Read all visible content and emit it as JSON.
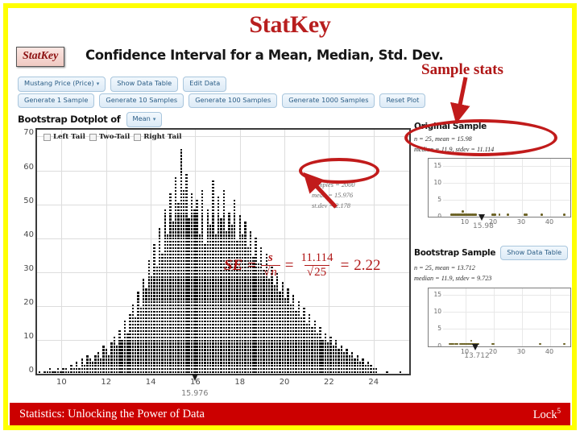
{
  "slide": {
    "title": "StatKey",
    "frame_color": "#ffff00",
    "accent_color": "#b01616"
  },
  "app": {
    "logo": "StatKey",
    "title": "Confidence Interval for a Mean, Median, Std. Dev.",
    "toolbar_row1": [
      {
        "label": "Mustang Price (Price)",
        "caret": "▾"
      },
      {
        "label": "Show Data Table",
        "caret": ""
      },
      {
        "label": "Edit Data",
        "caret": ""
      }
    ],
    "toolbar_row2": [
      {
        "label": "Generate 1 Sample",
        "caret": ""
      },
      {
        "label": "Generate 10 Samples",
        "caret": ""
      },
      {
        "label": "Generate 100 Samples",
        "caret": ""
      },
      {
        "label": "Generate 1000 Samples",
        "caret": ""
      },
      {
        "label": "Reset Plot",
        "caret": ""
      }
    ],
    "dotplot_heading": "Bootstrap Dotplot of",
    "statistic_select": "Mean",
    "statistic_caret": "▾",
    "tails": [
      {
        "label": "Left Tail",
        "checked": false
      },
      {
        "label": "Two-Tail",
        "checked": false
      },
      {
        "label": "Right Tail",
        "checked": false
      }
    ]
  },
  "main_plot_stats": {
    "samples": "samples = 2000",
    "mean": "mean = 15.976",
    "stdev": "st.dev = 2.178"
  },
  "se_formula": {
    "lhs": "SE",
    "eq1": "=",
    "s": "s",
    "n": "n",
    "eq2": "=",
    "numerator": "11.114",
    "denominator": "25",
    "eq3": "=",
    "result": "2.22"
  },
  "annotations": {
    "sample_stats_label": "Sample stats"
  },
  "original_sample": {
    "title": "Original Sample",
    "line1": "n = 25, mean = 15.98",
    "line2": "median = 11.9, stdev = 11.114",
    "marker_label": "15.98"
  },
  "bootstrap_sample": {
    "title": "Bootstrap Sample",
    "button_label": "Show Data Table",
    "line1": "n = 25, mean = 13.712",
    "line2": "median = 11.9, stdev = 9.723",
    "marker_label": "13.712"
  },
  "footer": {
    "left": "Statistics: Unlocking the Power of Data",
    "right": "Lock",
    "right_sup": "5",
    "bar_color": "#cc0000"
  },
  "chart_data": [
    {
      "type": "bar",
      "name": "bootstrap-dotplot-main",
      "title": "Bootstrap Dotplot of Mean",
      "xlabel": "",
      "ylabel": "",
      "xlim": [
        8.9,
        25.6
      ],
      "ylim": [
        0,
        72
      ],
      "xticks": [
        10,
        12,
        14,
        16,
        18,
        20,
        22,
        24
      ],
      "yticks": [
        0,
        10,
        20,
        30,
        40,
        50,
        60,
        70
      ],
      "grid": true,
      "marker_value": 15.976,
      "marker_label": "15.976",
      "samples": 2000,
      "mean": 15.976,
      "stdev": 2.178,
      "bin_width": 0.12,
      "x": [
        9.0,
        9.12,
        9.24,
        9.36,
        9.48,
        9.6,
        9.72,
        9.84,
        9.96,
        10.08,
        10.2,
        10.32,
        10.44,
        10.56,
        10.68,
        10.8,
        10.92,
        11.04,
        11.16,
        11.28,
        11.4,
        11.52,
        11.64,
        11.76,
        11.88,
        12.0,
        12.12,
        12.24,
        12.36,
        12.48,
        12.6,
        12.72,
        12.84,
        12.96,
        13.08,
        13.2,
        13.32,
        13.44,
        13.56,
        13.68,
        13.8,
        13.92,
        14.04,
        14.16,
        14.28,
        14.4,
        14.52,
        14.64,
        14.76,
        14.88,
        15.0,
        15.12,
        15.24,
        15.36,
        15.48,
        15.6,
        15.72,
        15.84,
        15.96,
        16.08,
        16.2,
        16.32,
        16.44,
        16.56,
        16.68,
        16.8,
        16.92,
        17.04,
        17.16,
        17.28,
        17.4,
        17.52,
        17.64,
        17.76,
        17.88,
        18.0,
        18.12,
        18.24,
        18.36,
        18.48,
        18.6,
        18.72,
        18.84,
        18.96,
        19.08,
        19.2,
        19.32,
        19.44,
        19.56,
        19.68,
        19.8,
        19.92,
        20.04,
        20.16,
        20.28,
        20.4,
        20.52,
        20.64,
        20.76,
        20.88,
        21.0,
        21.12,
        21.24,
        21.36,
        21.48,
        21.6,
        21.72,
        21.84,
        21.96,
        22.08,
        22.2,
        22.32,
        22.44,
        22.56,
        22.68,
        22.8,
        22.92,
        23.04,
        23.16,
        23.28,
        23.4,
        23.52,
        23.64,
        23.76,
        23.88,
        24.0,
        24.12,
        24.6,
        25.2
      ],
      "counts": [
        1,
        0,
        1,
        1,
        2,
        1,
        1,
        2,
        1,
        2,
        2,
        1,
        3,
        2,
        4,
        2,
        5,
        3,
        6,
        5,
        4,
        6,
        7,
        5,
        9,
        8,
        6,
        10,
        12,
        9,
        14,
        11,
        17,
        13,
        19,
        22,
        18,
        26,
        21,
        30,
        27,
        36,
        31,
        41,
        34,
        46,
        38,
        52,
        44,
        57,
        48,
        62,
        54,
        71,
        58,
        63,
        49,
        57,
        52,
        55,
        44,
        58,
        41,
        52,
        47,
        61,
        44,
        56,
        49,
        58,
        45,
        51,
        47,
        55,
        42,
        50,
        44,
        48,
        40,
        45,
        37,
        43,
        35,
        40,
        33,
        38,
        30,
        34,
        28,
        32,
        26,
        29,
        24,
        27,
        22,
        25,
        20,
        23,
        18,
        21,
        16,
        19,
        15,
        17,
        13,
        15,
        11,
        13,
        10,
        12,
        9,
        11,
        8,
        9,
        7,
        8,
        6,
        7,
        5,
        6,
        4,
        5,
        3,
        4,
        3,
        2,
        2,
        1,
        1
      ]
    },
    {
      "type": "scatter",
      "name": "original-sample-dotplot",
      "title": "Original Sample",
      "xlim": [
        2,
        46
      ],
      "ylim": [
        0,
        17
      ],
      "xticks": [
        10,
        20,
        30,
        40
      ],
      "yticks": [
        0,
        5,
        10,
        15
      ],
      "grid": true,
      "n": 25,
      "mean": 15.98,
      "median": 11.9,
      "stdev": 11.114,
      "marker_value": 15.98,
      "values": [
        5.0,
        5.5,
        6.0,
        6.5,
        7.0,
        7.5,
        8.0,
        8.5,
        9.0,
        9.2,
        9.5,
        10.0,
        10.5,
        11.0,
        11.5,
        11.9,
        12.5,
        13.0,
        13.5,
        19.5,
        20.0,
        20.5,
        22.0,
        25.0,
        31.0,
        31.5,
        37.0,
        45.0
      ]
    },
    {
      "type": "scatter",
      "name": "bootstrap-sample-dotplot",
      "title": "Bootstrap Sample",
      "xlim": [
        2,
        46
      ],
      "ylim": [
        0,
        17
      ],
      "xticks": [
        10,
        20,
        30,
        40
      ],
      "yticks": [
        0,
        5,
        10,
        15
      ],
      "grid": true,
      "n": 25,
      "mean": 13.712,
      "median": 11.9,
      "stdev": 9.723,
      "marker_value": 13.712,
      "values": [
        4.5,
        5.0,
        5.5,
        6.5,
        7.0,
        8.0,
        8.5,
        9.0,
        9.5,
        10.0,
        10.5,
        11.0,
        11.5,
        11.9,
        12.0,
        12.5,
        13.0,
        13.5,
        14.0,
        14.5,
        19.5,
        20.0,
        36.5,
        45.0
      ]
    }
  ]
}
